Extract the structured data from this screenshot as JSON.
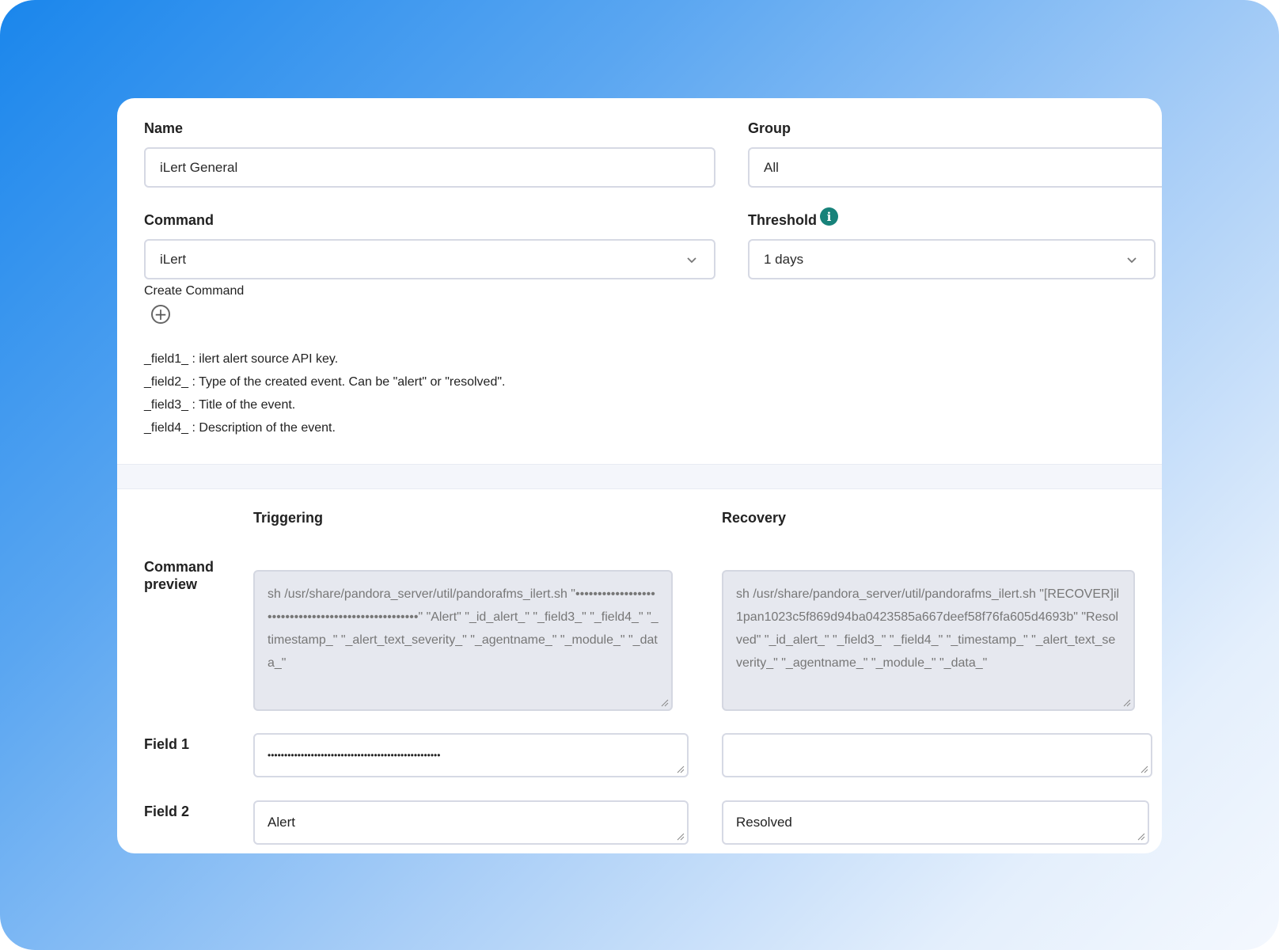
{
  "form": {
    "name_label": "Name",
    "name_value": "iLert General",
    "group_label": "Group",
    "group_value": "All",
    "command_label": "Command",
    "command_value": "iLert",
    "threshold_label": "Threshold",
    "threshold_value": "1 days",
    "create_command_label": "Create Command"
  },
  "help_lines": [
    "_field1_ : ilert alert source API key.",
    "_field2_ : Type of the created event. Can be \"alert\" or \"resolved\".",
    "_field3_ : Title of the event.",
    "_field4_ : Description of the event."
  ],
  "table": {
    "triggering_header": "Triggering",
    "recovery_header": "Recovery",
    "command_preview_label": "Command preview",
    "triggering_preview": "sh /usr/share/pandora_server/util/pandorafms_ilert.sh \"••••••••••••••••••••••••••••••••••••••••••••••••••••\" \"Alert\" \"_id_alert_\" \"_field3_\" \"_field4_\" \"_timestamp_\" \"_alert_text_severity_\" \"_agentname_\" \"_module_\" \"_data_\"",
    "recovery_preview": "sh /usr/share/pandora_server/util/pandorafms_ilert.sh \"[RECOVER]il1pan1023c5f869d94ba0423585a667deef58f76fa605d4693b\" \"Resolved\" \"_id_alert_\" \"_field3_\" \"_field4_\" \"_timestamp_\" \"_alert_text_severity_\" \"_agentname_\" \"_module_\" \"_data_\"",
    "field1_label": "Field 1",
    "field1_triggering": "••••••••••••••••••••••••••••••••••••••••••••••••••••",
    "field1_recovery": "",
    "field2_label": "Field 2",
    "field2_triggering": "Alert",
    "field2_recovery": "Resolved"
  },
  "icons": {
    "info": "info-icon",
    "add": "plus-circle-icon",
    "dropdown": "chevron-down-icon"
  },
  "colors": {
    "accent_info": "#17827a"
  }
}
